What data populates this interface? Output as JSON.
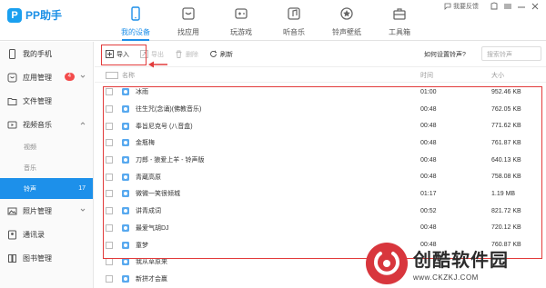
{
  "app": {
    "name": "PP助手",
    "feedback": "我要反馈",
    "brand_color": "#1d8fe9"
  },
  "nav": [
    {
      "label": "我的设备",
      "icon": "phone-icon",
      "active": true
    },
    {
      "label": "找应用",
      "icon": "app-store-icon"
    },
    {
      "label": "玩游戏",
      "icon": "gamepad-icon"
    },
    {
      "label": "听音乐",
      "icon": "music-icon"
    },
    {
      "label": "铃声壁纸",
      "icon": "wallpaper-icon"
    },
    {
      "label": "工具箱",
      "icon": "toolbox-icon"
    }
  ],
  "sidebar": {
    "items": [
      {
        "label": "我的手机",
        "icon": "phone-icon"
      },
      {
        "label": "应用管理",
        "icon": "app-icon",
        "badge": "4"
      },
      {
        "label": "文件管理",
        "icon": "folder-icon"
      },
      {
        "label": "视频音乐",
        "icon": "video-music-icon"
      }
    ],
    "sub_items": [
      {
        "label": "视频"
      },
      {
        "label": "音乐"
      },
      {
        "label": "铃声",
        "count": "17",
        "active": true
      }
    ],
    "items_bottom": [
      {
        "label": "照片管理",
        "icon": "photo-icon"
      },
      {
        "label": "通讯录",
        "icon": "contacts-icon"
      },
      {
        "label": "图书管理",
        "icon": "book-icon"
      }
    ]
  },
  "toolbar": {
    "import": "导入",
    "export": "导出",
    "delete": "删除",
    "refresh": "刷新",
    "ringtone_help": "如何设置铃声?",
    "search_placeholder": "搜索铃声"
  },
  "table": {
    "headers": {
      "name": "名称",
      "time": "时间",
      "size": "大小"
    },
    "rows": [
      {
        "name": "冰雨",
        "time": "01:00",
        "size": "952.46 KB"
      },
      {
        "name": "往生咒(念诵)(佛教音乐)",
        "time": "00:48",
        "size": "762.05 KB"
      },
      {
        "name": "奉旨尼克号 (八音盒)",
        "time": "00:48",
        "size": "771.62 KB"
      },
      {
        "name": "金瓶梅",
        "time": "00:48",
        "size": "761.87 KB"
      },
      {
        "name": "刀郎 - 狼爱上羊 - 铃声版",
        "time": "00:48",
        "size": "640.13 KB"
      },
      {
        "name": "青蔵高原",
        "time": "00:48",
        "size": "758.08 KB"
      },
      {
        "name": "微微一笑很倾城",
        "time": "01:17",
        "size": "1.19 MB"
      },
      {
        "name": "讲青成词",
        "time": "00:52",
        "size": "821.72 KB"
      },
      {
        "name": "最爱气胡DJ",
        "time": "00:48",
        "size": "720.12 KB"
      },
      {
        "name": "童梦",
        "time": "00:48",
        "size": "760.87 KB"
      },
      {
        "name": "我从草原来",
        "time": "",
        "size": ""
      },
      {
        "name": "新拼才会赢",
        "time": "",
        "size": ""
      }
    ]
  },
  "watermark": {
    "title": "创酷软件园",
    "url": "www.CKZKJ.COM"
  }
}
